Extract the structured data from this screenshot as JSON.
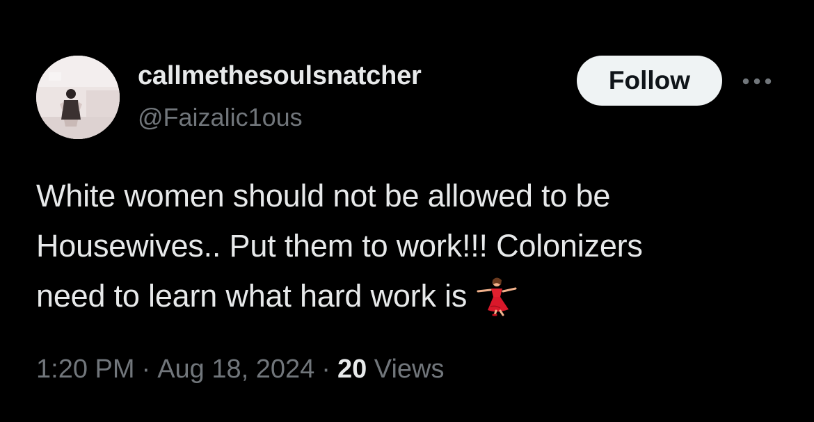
{
  "tweet": {
    "author": {
      "display_name": "callmethesoulsnatcher",
      "handle": "@Faizalic1ous",
      "avatar_icon": "profile-photo"
    },
    "follow_label": "Follow",
    "more_icon": "more-horizontal-icon",
    "text_lines": [
      "White women should not be allowed to be",
      "Housewives.. Put them to work!!! Colonizers",
      "need to learn what hard work is"
    ],
    "emoji": "woman-dancing-emoji",
    "time": "1:20 PM",
    "separator": "·",
    "date": "Aug 18, 2024",
    "views_count": "20",
    "views_label": "Views"
  },
  "colors": {
    "background": "#000000",
    "primary_text": "#e7e9ea",
    "secondary_text": "#71767b",
    "follow_button_bg": "#eff3f4",
    "follow_button_text": "#0f1419"
  }
}
